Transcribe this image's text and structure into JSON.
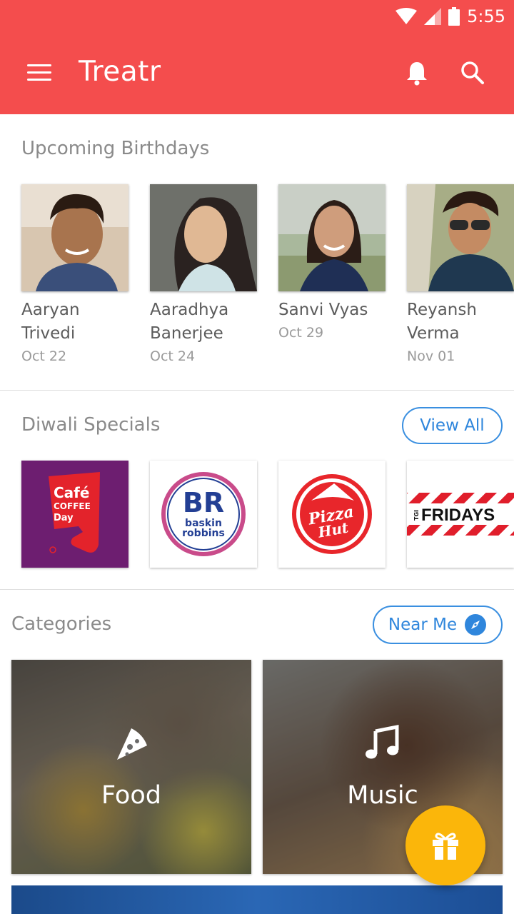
{
  "status_bar": {
    "time": "5:55"
  },
  "app_bar": {
    "title": "Treatr",
    "icons": [
      "menu-icon",
      "bell-icon",
      "search-icon"
    ]
  },
  "birthdays": {
    "title": "Upcoming Birthdays",
    "people": [
      {
        "first": "Aaryan",
        "last": "Trivedi",
        "date": "Oct 22"
      },
      {
        "first": "Aaradhya",
        "last": "Banerjee",
        "date": "Oct 24"
      },
      {
        "first": "Sanvi Vyas",
        "last": "",
        "date": "Oct 29"
      },
      {
        "first": "Reyansh",
        "last": "Verma",
        "date": "Nov 01"
      }
    ]
  },
  "specials": {
    "title": "Diwali Specials",
    "view_all": "View All",
    "brands": [
      {
        "text_lines": [
          "Café",
          "COFFEE",
          "Day"
        ]
      },
      {
        "text_lines": [
          "BR",
          "baskin",
          "robbins"
        ]
      },
      {
        "text_lines": [
          "Pizza",
          "Hut"
        ]
      },
      {
        "text_lines": [
          "TGI",
          "FRIDAYS"
        ]
      }
    ]
  },
  "categories": {
    "title": "Categories",
    "near_me": "Near Me",
    "items": [
      {
        "label": "Food",
        "icon": "pizza-slice-icon"
      },
      {
        "label": "Music",
        "icon": "music-note-icon"
      }
    ]
  },
  "fab": {
    "icon": "gift-icon"
  },
  "colors": {
    "primary": "#f44d4d",
    "accent": "#fbb60a",
    "link": "#2f86dc"
  }
}
